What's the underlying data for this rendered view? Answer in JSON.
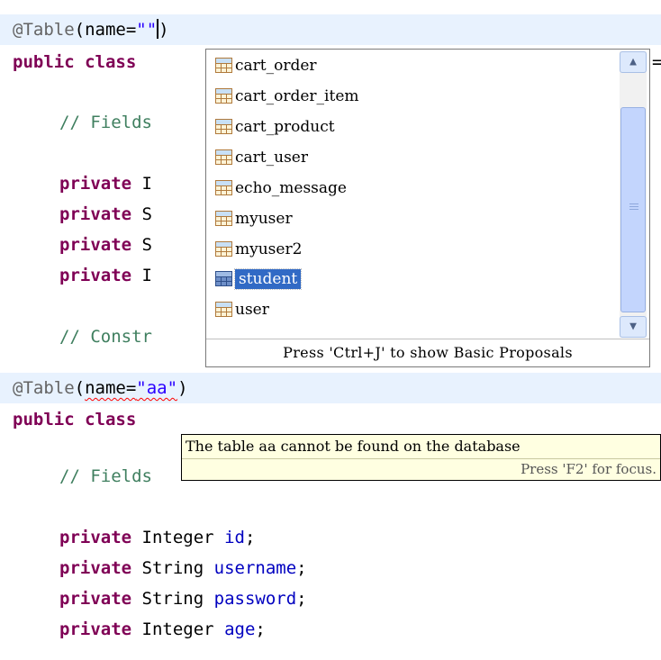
{
  "top": {
    "annotation_prefix": "@Table",
    "annotation_open": "(name=",
    "annotation_value": "\"\"",
    "annotation_close": ")",
    "class_kw": "public class",
    "comment_fields": "// Fields",
    "private_kw": "private",
    "field_type_partials": [
      "I",
      "S",
      "S",
      "I"
    ],
    "comment_constr": "// Constr",
    "clipped_char": "="
  },
  "popup": {
    "items": [
      {
        "label": "cart_order",
        "icon": "table-icon"
      },
      {
        "label": "cart_order_item",
        "icon": "table-icon"
      },
      {
        "label": "cart_product",
        "icon": "table-icon"
      },
      {
        "label": "cart_user",
        "icon": "table-icon"
      },
      {
        "label": "echo_message",
        "icon": "table-icon"
      },
      {
        "label": "myuser",
        "icon": "table-icon"
      },
      {
        "label": "myuser2",
        "icon": "table-icon"
      },
      {
        "label": "student",
        "icon": "table-icon"
      },
      {
        "label": "user",
        "icon": "table-icon"
      }
    ],
    "selected_index": 7,
    "footer": "Press 'Ctrl+J' to show Basic Proposals",
    "scroll_up_glyph": "▲",
    "scroll_down_glyph": "▼"
  },
  "bottom": {
    "annotation_prefix": "@Table",
    "annotation_open": "(",
    "annotation_name": "name=",
    "annotation_value": "\"aa\"",
    "annotation_close": ")",
    "class_kw": "public class",
    "comment_fields": "// Fields",
    "private_kw": "private",
    "fields": [
      {
        "type": "Integer",
        "name": "id"
      },
      {
        "type": "String",
        "name": "username"
      },
      {
        "type": "String",
        "name": "password"
      },
      {
        "type": "Integer",
        "name": "age"
      }
    ],
    "terminator": ";"
  },
  "tooltip": {
    "message": "The table aa cannot be found on the database",
    "footer": "Press 'F2' for focus."
  },
  "colors": {
    "keyword": "#7f0055",
    "comment": "#3f7f5f",
    "string": "#2a00ff",
    "field": "#0000c0",
    "selection": "#316ac5",
    "tooltip_bg": "#ffffe1",
    "current_line": "#e8f2fe"
  }
}
